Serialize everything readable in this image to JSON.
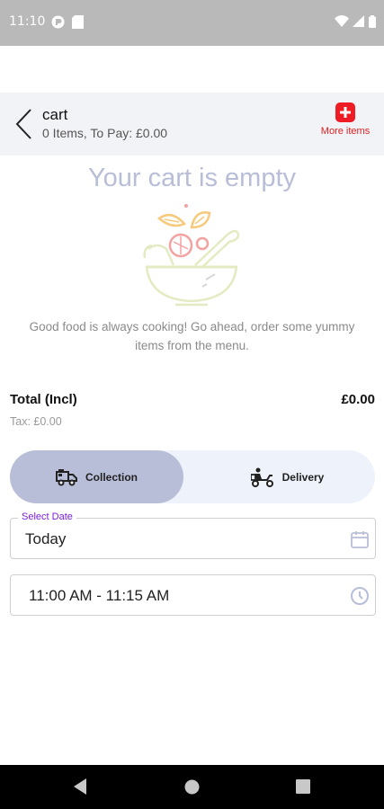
{
  "status_bar": {
    "time": "11:10"
  },
  "header": {
    "title": "cart",
    "subtitle": "0 Items, To Pay: £0.00",
    "more_items_label": "More items"
  },
  "empty_state": {
    "title": "Your cart is empty",
    "message": "Good food is always cooking! Go ahead, order some yummy items from the menu."
  },
  "totals": {
    "total_label": "Total (Incl)",
    "total_value": "£0.00",
    "tax_label": "Tax: £0.00"
  },
  "order_type": {
    "options": [
      {
        "label": "Collection",
        "icon": "truck-icon",
        "selected": true
      },
      {
        "label": "Delivery",
        "icon": "delivery-scooter-icon",
        "selected": false
      }
    ]
  },
  "date_field": {
    "label": "Select Date",
    "value": "Today",
    "icon": "calendar-icon"
  },
  "time_field": {
    "value": "11:00 AM - 11:15 AM",
    "icon": "clock-icon"
  },
  "colors": {
    "accent": "#b9bed8",
    "more_items": "#e02020",
    "date_label": "#7b1fe0"
  }
}
